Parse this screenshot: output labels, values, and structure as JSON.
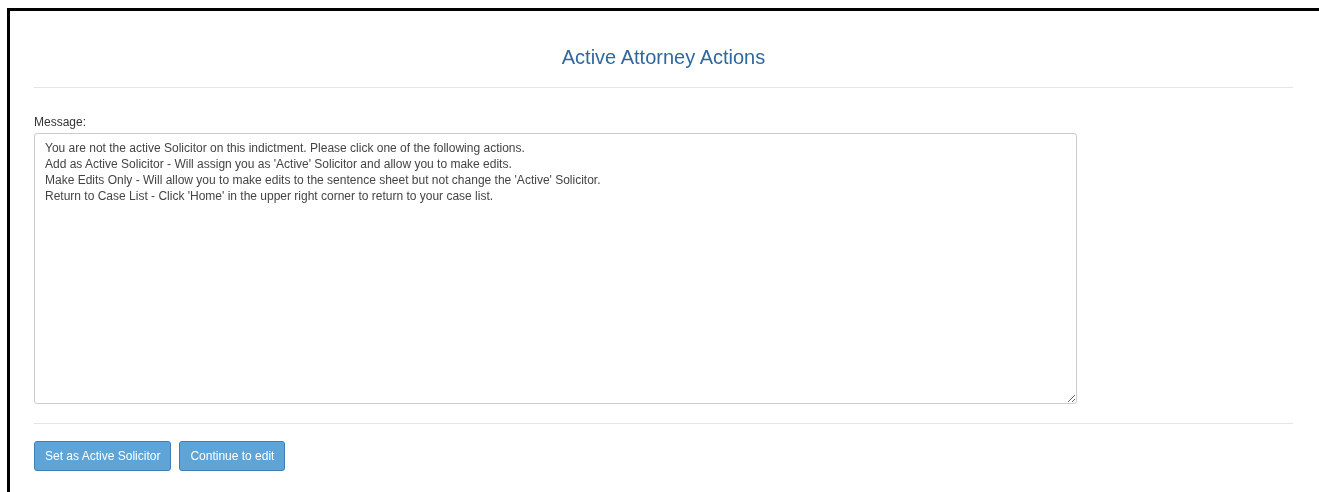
{
  "dialog": {
    "title": "Active Attorney Actions",
    "message": {
      "label": "Message:",
      "lines": [
        "You are not the active Solicitor on this indictment. Please click one of the following actions.",
        "Add as Active Solicitor - Will assign you as 'Active' Solicitor and allow you to make edits.",
        "Make Edits Only - Will allow you to make edits to the sentence sheet but not change the 'Active' Solicitor.",
        "Return to Case List - Click 'Home' in the upper right corner to return to your case list."
      ]
    },
    "buttons": [
      {
        "label": "Set as Active Solicitor"
      },
      {
        "label": "Continue to edit"
      }
    ]
  }
}
